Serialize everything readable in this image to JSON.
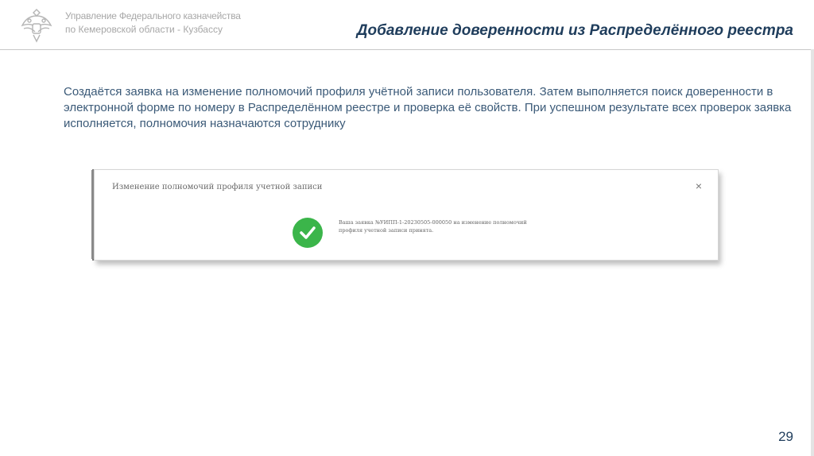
{
  "header": {
    "org_line1": "Управление Федерального казначейства",
    "org_line2": "по Кемеровской области - Кузбассу",
    "title": "Добавление доверенности из Распределённого реестра"
  },
  "description": "Создаётся заявка на изменение полномочий профиля учётной записи пользователя. Затем выполняется поиск доверенности в электронной форме по номеру в Распределённом реестре и проверка её свойств. При успешном результате всех проверок заявка исполняется, полномочия назначаются сотруднику",
  "dialog": {
    "title": "Изменение полномочий профиля учетной записи",
    "close": "×",
    "message": "Ваша заявка №УИПП-1-20230505-000050 на изменение полномочий профиля учетной записи принята.",
    "status_color": "#3bb54a"
  },
  "page_number": "29",
  "colors": {
    "title": "#1f3d5c",
    "text": "#3b5a78",
    "org": "#a7a7a7"
  }
}
